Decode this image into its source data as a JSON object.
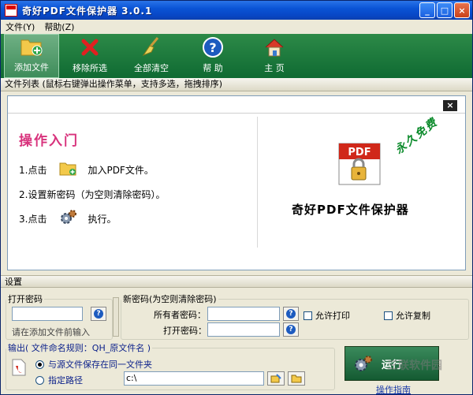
{
  "window": {
    "title": "奇好PDF文件保护器 3.0.1",
    "minimize_glyph": "_",
    "maximize_glyph": "□",
    "close_glyph": "×"
  },
  "menu": {
    "items": [
      {
        "label": "文件(Y)"
      },
      {
        "label": "帮助(Z)"
      }
    ]
  },
  "toolbar": {
    "items": [
      {
        "label": "添加文件",
        "icon": "folder-add-icon"
      },
      {
        "label": "移除所选",
        "icon": "red-x-icon"
      },
      {
        "label": "全部清空",
        "icon": "broom-icon"
      },
      {
        "label": "帮 助",
        "icon": "help-icon"
      },
      {
        "label": "主 页",
        "icon": "home-icon"
      }
    ],
    "bg_color": "#1a7a3c"
  },
  "filelist_bar": {
    "text": "文件列表  (鼠标右键弹出操作菜单，支持多选，拖拽排序)"
  },
  "intro": {
    "close_label": "×",
    "title": "操作入门",
    "step1_a": "1.点击",
    "step1_b": "加入PDF文件。",
    "step2": "2.设置新密码（为空则清除密码）。",
    "step3_a": "3.点击",
    "step3_b": "执行。",
    "product_name": "奇好PDF文件保护器",
    "badge_text": "PDF",
    "free_stamp": "永久免费"
  },
  "settings": {
    "label": "设置",
    "open_pwd_group": {
      "legend": "打开密码",
      "hint": "请在添加文件前输入",
      "value": ""
    },
    "new_pwd_group": {
      "legend": "新密码(为空则清除密码)",
      "owner_label": "所有者密码：",
      "owner_value": "",
      "open_label": "打开密码：",
      "open_value": "",
      "allow_print": "允许打印",
      "allow_copy": "允许复制"
    },
    "output_group": {
      "legend": "输出( 文件命名规则：QH_原文件名 )",
      "radio_same": "与源文件保存在同一文件夹",
      "radio_path": "指定路径",
      "path_value": "c:\\"
    }
  },
  "run": {
    "label": "运行",
    "guide": "操作指南"
  },
  "watermark": "三联软件园",
  "colors": {
    "toolbar_green": "#1a7a3c",
    "title_pink": "#d8327c",
    "free_green": "#0a8a2a"
  }
}
